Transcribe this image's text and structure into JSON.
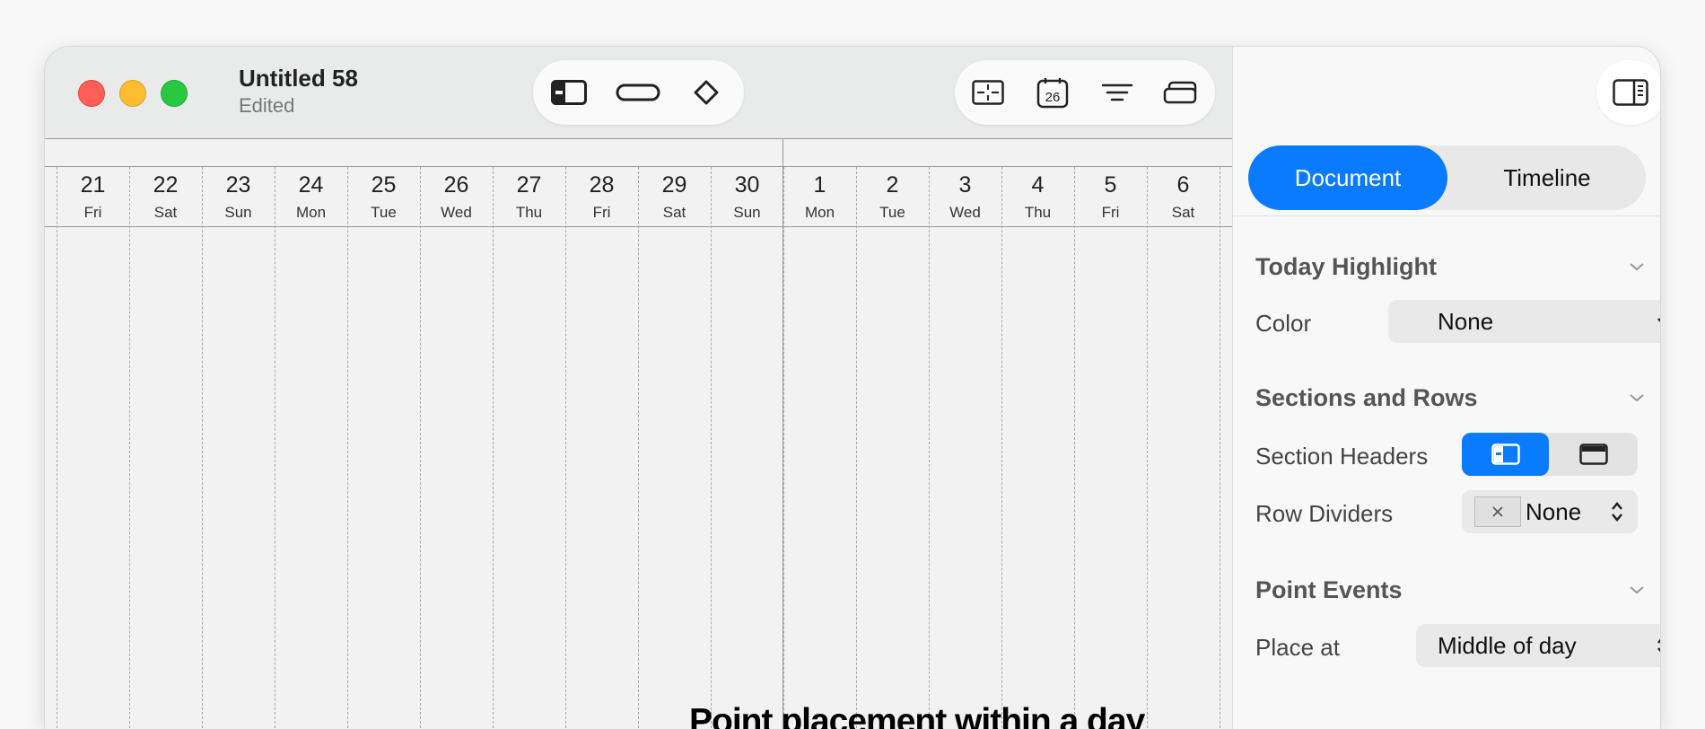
{
  "window": {
    "title": "Untitled 58",
    "subtitle": "Edited"
  },
  "toolbar": {
    "left_icons": [
      "sidebar-icon",
      "bar-item-icon",
      "milestone-diamond-icon"
    ],
    "right_icons": [
      "view-split-icon",
      "calendar-icon",
      "filter-lines-icon",
      "stack-icon"
    ],
    "calendar_day": "26"
  },
  "timeline": {
    "days": [
      {
        "num": "21",
        "dow": "Fri"
      },
      {
        "num": "22",
        "dow": "Sat"
      },
      {
        "num": "23",
        "dow": "Sun"
      },
      {
        "num": "24",
        "dow": "Mon"
      },
      {
        "num": "25",
        "dow": "Tue"
      },
      {
        "num": "26",
        "dow": "Wed"
      },
      {
        "num": "27",
        "dow": "Thu"
      },
      {
        "num": "28",
        "dow": "Fri"
      },
      {
        "num": "29",
        "dow": "Sat"
      },
      {
        "num": "30",
        "dow": "Sun"
      },
      {
        "num": "1",
        "dow": "Mon"
      },
      {
        "num": "2",
        "dow": "Tue"
      },
      {
        "num": "3",
        "dow": "Wed"
      },
      {
        "num": "4",
        "dow": "Thu"
      },
      {
        "num": "5",
        "dow": "Fri"
      },
      {
        "num": "6",
        "dow": "Sat"
      }
    ],
    "annotation": "Point placement within a day"
  },
  "inspector": {
    "tabs": [
      {
        "label": "Document",
        "active": true
      },
      {
        "label": "Timeline",
        "active": false
      }
    ],
    "today_highlight": {
      "title": "Today Highlight",
      "color_label": "Color",
      "color_value": "None"
    },
    "sections_rows": {
      "title": "Sections and Rows",
      "section_headers_label": "Section Headers",
      "row_dividers_label": "Row Dividers",
      "row_dividers_value": "None"
    },
    "point_events": {
      "title": "Point Events",
      "place_at_label": "Place at",
      "place_at_value": "Middle of day"
    }
  },
  "colors": {
    "accent": "#0a7aff",
    "traffic_red": "#ff5f57",
    "traffic_yellow": "#febc2e",
    "traffic_green": "#28c840"
  }
}
